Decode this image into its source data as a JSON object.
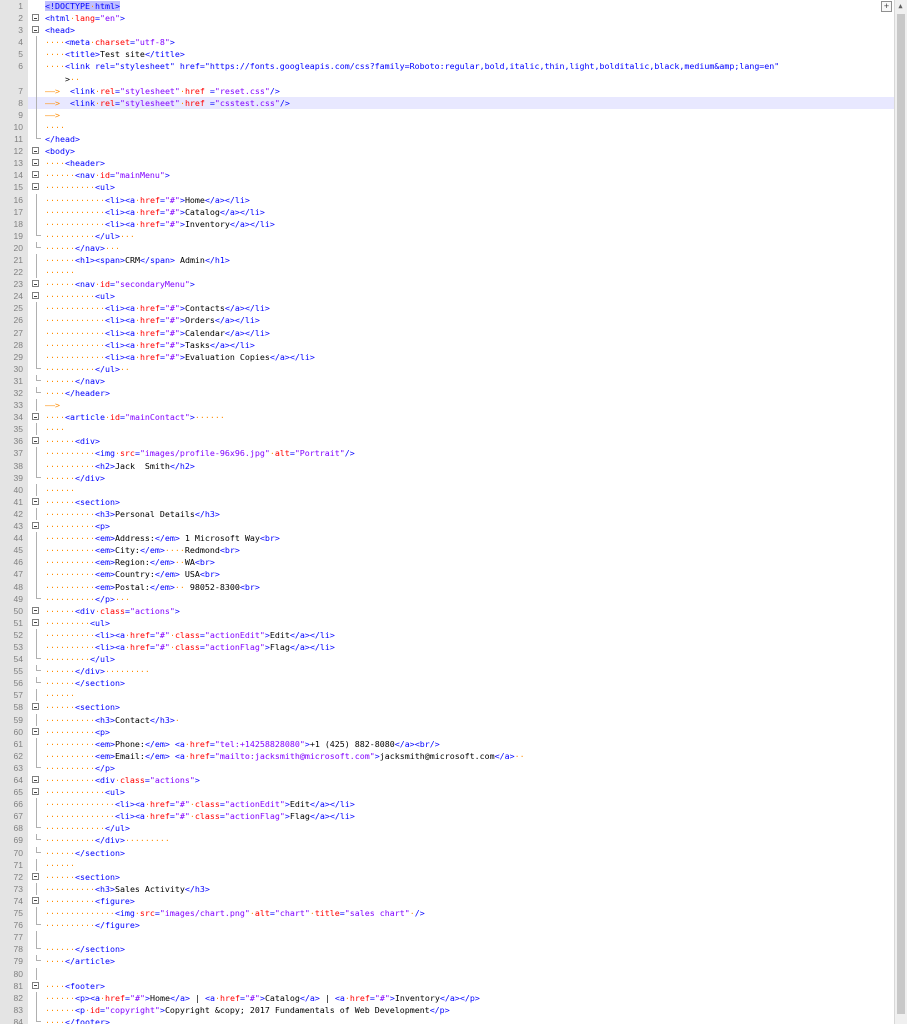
{
  "editor": {
    "lines": [
      {
        "n": "1",
        "text": "<!DOCTYPE html>",
        "fold": "none",
        "hl": false
      },
      {
        "n": "2",
        "text": "<html lang=\"en\">",
        "fold": "open",
        "hl": false
      },
      {
        "n": "3",
        "text": "<head>",
        "fold": "open",
        "hl": false
      },
      {
        "n": "4",
        "text": "····<meta charset=\"utf-8\">",
        "fold": "line",
        "hl": false
      },
      {
        "n": "5",
        "text": "····<title>Test site</title>",
        "fold": "line",
        "hl": false
      },
      {
        "n": "6",
        "text": "····<link rel=\"stylesheet\" href=\"https://fonts.googleapis.com/css?family=Roboto:regular,bold,italic,thin,light,bolditalic,black,medium&amp;lang=en\"",
        "fold": "line",
        "hl": false
      },
      {
        "n": "",
        "text": "    >··",
        "fold": "line",
        "hl": false
      },
      {
        "n": "7",
        "text": "——>  <link rel=\"stylesheet\" href =\"reset.css\"/>",
        "fold": "line",
        "hl": false
      },
      {
        "n": "8",
        "text": "——>  <link rel=\"stylesheet\" href =\"csstest.css\"/>",
        "fold": "line",
        "hl": true
      },
      {
        "n": "9",
        "text": "——>",
        "fold": "line",
        "hl": false
      },
      {
        "n": "10",
        "text": "····",
        "fold": "line",
        "hl": false
      },
      {
        "n": "11",
        "text": "</head>",
        "fold": "end",
        "hl": false
      },
      {
        "n": "12",
        "text": "<body>",
        "fold": "open",
        "hl": false
      },
      {
        "n": "13",
        "text": "····<header>",
        "fold": "open",
        "hl": false
      },
      {
        "n": "14",
        "text": "······<nav id=\"mainMenu\">",
        "fold": "open",
        "hl": false
      },
      {
        "n": "15",
        "text": "··········<ul>",
        "fold": "open",
        "hl": false
      },
      {
        "n": "16",
        "text": "············<li><a href=\"#\">Home</a></li>",
        "fold": "line",
        "hl": false
      },
      {
        "n": "17",
        "text": "············<li><a href=\"#\">Catalog</a></li>",
        "fold": "line",
        "hl": false
      },
      {
        "n": "18",
        "text": "············<li><a href=\"#\">Inventory</a></li>",
        "fold": "line",
        "hl": false
      },
      {
        "n": "19",
        "text": "··········</ul>···",
        "fold": "end",
        "hl": false
      },
      {
        "n": "20",
        "text": "······</nav>···",
        "fold": "end",
        "hl": false
      },
      {
        "n": "21",
        "text": "······<h1><span>CRM</span> Admin</h1>",
        "fold": "line",
        "hl": false
      },
      {
        "n": "22",
        "text": "······",
        "fold": "line",
        "hl": false
      },
      {
        "n": "23",
        "text": "······<nav id=\"secondaryMenu\">",
        "fold": "open",
        "hl": false
      },
      {
        "n": "24",
        "text": "··········<ul>",
        "fold": "open",
        "hl": false
      },
      {
        "n": "25",
        "text": "············<li><a href=\"#\">Contacts</a></li>",
        "fold": "line",
        "hl": false
      },
      {
        "n": "26",
        "text": "············<li><a href=\"#\">Orders</a></li>",
        "fold": "line",
        "hl": false
      },
      {
        "n": "27",
        "text": "············<li><a href=\"#\">Calendar</a></li>",
        "fold": "line",
        "hl": false
      },
      {
        "n": "28",
        "text": "············<li><a href=\"#\">Tasks</a></li>",
        "fold": "line",
        "hl": false
      },
      {
        "n": "29",
        "text": "············<li><a href=\"#\">Evaluation Copies</a></li>",
        "fold": "line",
        "hl": false
      },
      {
        "n": "30",
        "text": "··········</ul>··",
        "fold": "end",
        "hl": false
      },
      {
        "n": "31",
        "text": "······</nav>",
        "fold": "end",
        "hl": false
      },
      {
        "n": "32",
        "text": "····</header>",
        "fold": "end",
        "hl": false
      },
      {
        "n": "33",
        "text": "——>",
        "fold": "line",
        "hl": false
      },
      {
        "n": "34",
        "text": "····<article id=\"mainContact\">······",
        "fold": "open",
        "hl": false
      },
      {
        "n": "35",
        "text": "····",
        "fold": "line",
        "hl": false
      },
      {
        "n": "36",
        "text": "······<div>",
        "fold": "open",
        "hl": false
      },
      {
        "n": "37",
        "text": "··········<img src=\"images/profile-96x96.jpg\" alt=\"Portrait\"/>",
        "fold": "line",
        "hl": false
      },
      {
        "n": "38",
        "text": "··········<h2>Jack  Smith</h2>",
        "fold": "line",
        "hl": false
      },
      {
        "n": "39",
        "text": "······</div>",
        "fold": "end",
        "hl": false
      },
      {
        "n": "40",
        "text": "······",
        "fold": "line",
        "hl": false
      },
      {
        "n": "41",
        "text": "······<section>",
        "fold": "open",
        "hl": false
      },
      {
        "n": "42",
        "text": "··········<h3>Personal Details</h3>",
        "fold": "line",
        "hl": false
      },
      {
        "n": "43",
        "text": "··········<p>",
        "fold": "open",
        "hl": false
      },
      {
        "n": "44",
        "text": "··········<em>Address:</em> 1 Microsoft Way<br>",
        "fold": "line",
        "hl": false
      },
      {
        "n": "45",
        "text": "··········<em>City:</em>····Redmond<br>",
        "fold": "line",
        "hl": false
      },
      {
        "n": "46",
        "text": "··········<em>Region:</em>··WA<br>",
        "fold": "line",
        "hl": false
      },
      {
        "n": "47",
        "text": "··········<em>Country:</em> USA<br>",
        "fold": "line",
        "hl": false
      },
      {
        "n": "48",
        "text": "··········<em>Postal:</em>·· 98052-8300<br>",
        "fold": "line",
        "hl": false
      },
      {
        "n": "49",
        "text": "··········</p>···",
        "fold": "end",
        "hl": false
      },
      {
        "n": "50",
        "text": "······<div class=\"actions\">",
        "fold": "open",
        "hl": false
      },
      {
        "n": "51",
        "text": "·········<ul>",
        "fold": "open",
        "hl": false
      },
      {
        "n": "52",
        "text": "··········<li><a href=\"#\" class=\"actionEdit\">Edit</a></li>",
        "fold": "line",
        "hl": false
      },
      {
        "n": "53",
        "text": "··········<li><a href=\"#\" class=\"actionFlag\">Flag</a></li>",
        "fold": "line",
        "hl": false
      },
      {
        "n": "54",
        "text": "·········</ul>",
        "fold": "end",
        "hl": false
      },
      {
        "n": "55",
        "text": "······</div>·········",
        "fold": "end",
        "hl": false
      },
      {
        "n": "56",
        "text": "······</section>",
        "fold": "end",
        "hl": false
      },
      {
        "n": "57",
        "text": "······",
        "fold": "line",
        "hl": false
      },
      {
        "n": "58",
        "text": "······<section>",
        "fold": "open",
        "hl": false
      },
      {
        "n": "59",
        "text": "··········<h3>Contact</h3>·",
        "fold": "line",
        "hl": false
      },
      {
        "n": "60",
        "text": "··········<p>",
        "fold": "open",
        "hl": false
      },
      {
        "n": "61",
        "text": "··········<em>Phone:</em> <a href=\"tel:+14258828080\">+1 (425) 882-8080</a><br/>",
        "fold": "line",
        "hl": false
      },
      {
        "n": "62",
        "text": "··········<em>Email:</em> <a href=\"mailto:jacksmith@microsoft.com\">jacksmith@microsoft.com</a>··",
        "fold": "line",
        "hl": false
      },
      {
        "n": "63",
        "text": "··········</p>",
        "fold": "end",
        "hl": false
      },
      {
        "n": "64",
        "text": "··········<div class=\"actions\">",
        "fold": "open",
        "hl": false
      },
      {
        "n": "65",
        "text": "············<ul>",
        "fold": "open",
        "hl": false
      },
      {
        "n": "66",
        "text": "··············<li><a href=\"#\" class=\"actionEdit\">Edit</a></li>",
        "fold": "line",
        "hl": false
      },
      {
        "n": "67",
        "text": "··············<li><a href=\"#\" class=\"actionFlag\">Flag</a></li>",
        "fold": "line",
        "hl": false
      },
      {
        "n": "68",
        "text": "············</ul>",
        "fold": "end",
        "hl": false
      },
      {
        "n": "69",
        "text": "··········</div>·········",
        "fold": "end",
        "hl": false
      },
      {
        "n": "70",
        "text": "······</section>",
        "fold": "end",
        "hl": false
      },
      {
        "n": "71",
        "text": "······",
        "fold": "line",
        "hl": false
      },
      {
        "n": "72",
        "text": "······<section>",
        "fold": "open",
        "hl": false
      },
      {
        "n": "73",
        "text": "··········<h3>Sales Activity</h3>",
        "fold": "line",
        "hl": false
      },
      {
        "n": "74",
        "text": "··········<figure>",
        "fold": "open",
        "hl": false
      },
      {
        "n": "75",
        "text": "··············<img src=\"images/chart.png\" alt=\"chart\" title=\"sales chart\" />",
        "fold": "line",
        "hl": false
      },
      {
        "n": "76",
        "text": "··········</figure>",
        "fold": "end",
        "hl": false
      },
      {
        "n": "77",
        "text": "",
        "fold": "line",
        "hl": false
      },
      {
        "n": "78",
        "text": "······</section>",
        "fold": "end",
        "hl": false
      },
      {
        "n": "79",
        "text": "····</article>",
        "fold": "end",
        "hl": false
      },
      {
        "n": "80",
        "text": "",
        "fold": "line",
        "hl": false
      },
      {
        "n": "81",
        "text": "····<footer>",
        "fold": "open",
        "hl": false
      },
      {
        "n": "82",
        "text": "······<p><a href=\"#\">Home</a> | <a href=\"#\">Catalog</a> | <a href=\"#\">Inventory</a></p>",
        "fold": "line",
        "hl": false
      },
      {
        "n": "83",
        "text": "······<p id=\"copyright\">Copyright &copy; 2017 Fundamentals of Web Development</p>",
        "fold": "line",
        "hl": false
      },
      {
        "n": "84",
        "text": "····</footer>",
        "fold": "end",
        "hl": false
      }
    ]
  },
  "scrollbar": {
    "plus_label": "+",
    "up_arrow": "▲"
  },
  "colors": {
    "tag": "#0000ff",
    "attr": "#ff0000",
    "value": "#8000ff",
    "whitespace": "#ff8c00",
    "highlight": "#e8e8ff"
  }
}
